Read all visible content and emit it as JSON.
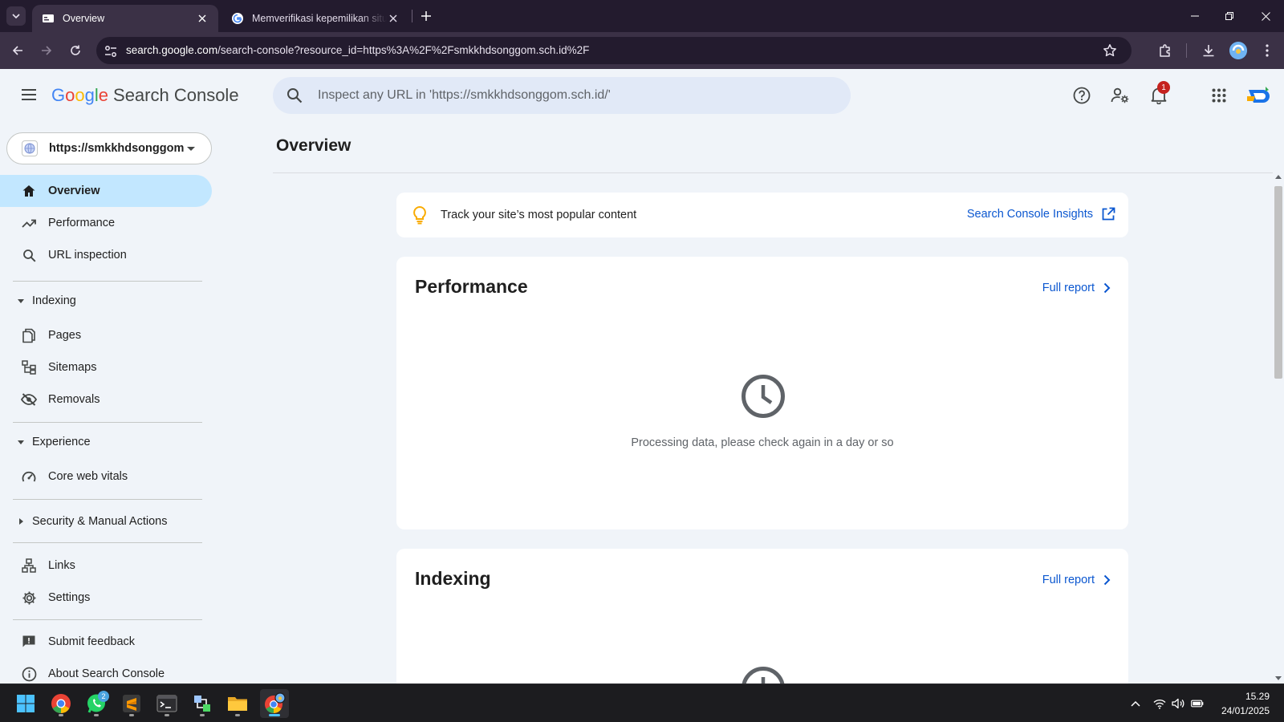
{
  "browser": {
    "tabs": [
      {
        "title": "Overview",
        "active": true
      },
      {
        "title": "Memverifikasi kepemilikan situs",
        "active": false
      }
    ],
    "address": {
      "host": "search.google.com",
      "path": "/search-console?resource_id=https%3A%2F%2Fsmkkhdsonggom.sch.id%2F"
    }
  },
  "header": {
    "logo": {
      "g1": "G",
      "o1": "o",
      "o2": "o",
      "g2": "g",
      "l": "l",
      "e": "e",
      "product": "Search Console"
    },
    "search_placeholder": "Inspect any URL in 'https://smkkhdsonggom.sch.id/'",
    "notification_count": "1"
  },
  "sidebar": {
    "property": "https://smkkhdsonggom.sch.id/",
    "items": {
      "overview": "Overview",
      "performance": "Performance",
      "url_inspection": "URL inspection",
      "indexing": "Indexing",
      "pages": "Pages",
      "sitemaps": "Sitemaps",
      "removals": "Removals",
      "experience": "Experience",
      "core_web_vitals": "Core web vitals",
      "security": "Security & Manual Actions",
      "links": "Links",
      "settings": "Settings",
      "submit_feedback": "Submit feedback",
      "about": "About Search Console"
    }
  },
  "main": {
    "title": "Overview",
    "insights": {
      "text": "Track your site’s most popular content",
      "link": "Search Console Insights"
    },
    "performance": {
      "title": "Performance",
      "link": "Full report",
      "message": "Processing data, please check again in a day or so"
    },
    "indexing": {
      "title": "Indexing",
      "link": "Full report"
    }
  },
  "taskbar": {
    "whatsapp_badge": "2",
    "time": "15.29",
    "date": "24/01/2025"
  },
  "colors": {
    "accent": "#0b57d0",
    "active_nav": "#c2e7ff",
    "page_bg": "#f0f4f9",
    "chrome_frame": "#231b2e",
    "chrome_toolbar": "#3b3146"
  }
}
